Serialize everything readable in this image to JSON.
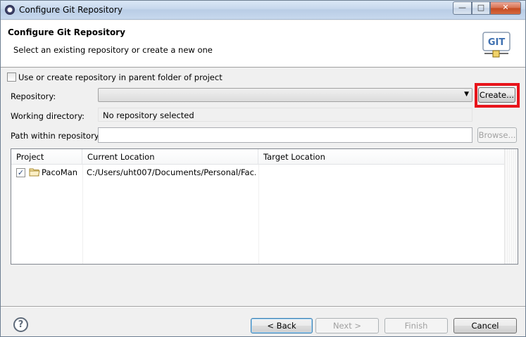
{
  "window": {
    "title": "Configure Git Repository"
  },
  "header": {
    "title": "Configure Git Repository",
    "subtitle": "Select an existing repository or create a new one",
    "logo_text": "GIT"
  },
  "form": {
    "parent_folder_checkbox_label": "Use or create repository in parent folder of project",
    "parent_folder_checked": false,
    "repository_label": "Repository:",
    "repository_value": "",
    "create_button": "Create...",
    "working_dir_label": "Working directory:",
    "working_dir_value": "No repository selected",
    "path_label": "Path within repository:",
    "path_value": "",
    "browse_button": "Browse..."
  },
  "table": {
    "columns": [
      "Project",
      "Current Location",
      "Target Location"
    ],
    "rows": [
      {
        "checked": true,
        "project": "PacoMan",
        "current_location": "C:/Users/uht007/Documents/Personal/Fac...",
        "target_location": ""
      }
    ]
  },
  "footer": {
    "help_icon": "?",
    "back_button": "< Back",
    "next_button": "Next >",
    "finish_button": "Finish",
    "cancel_button": "Cancel"
  },
  "colors": {
    "highlight": "#e8141b"
  }
}
